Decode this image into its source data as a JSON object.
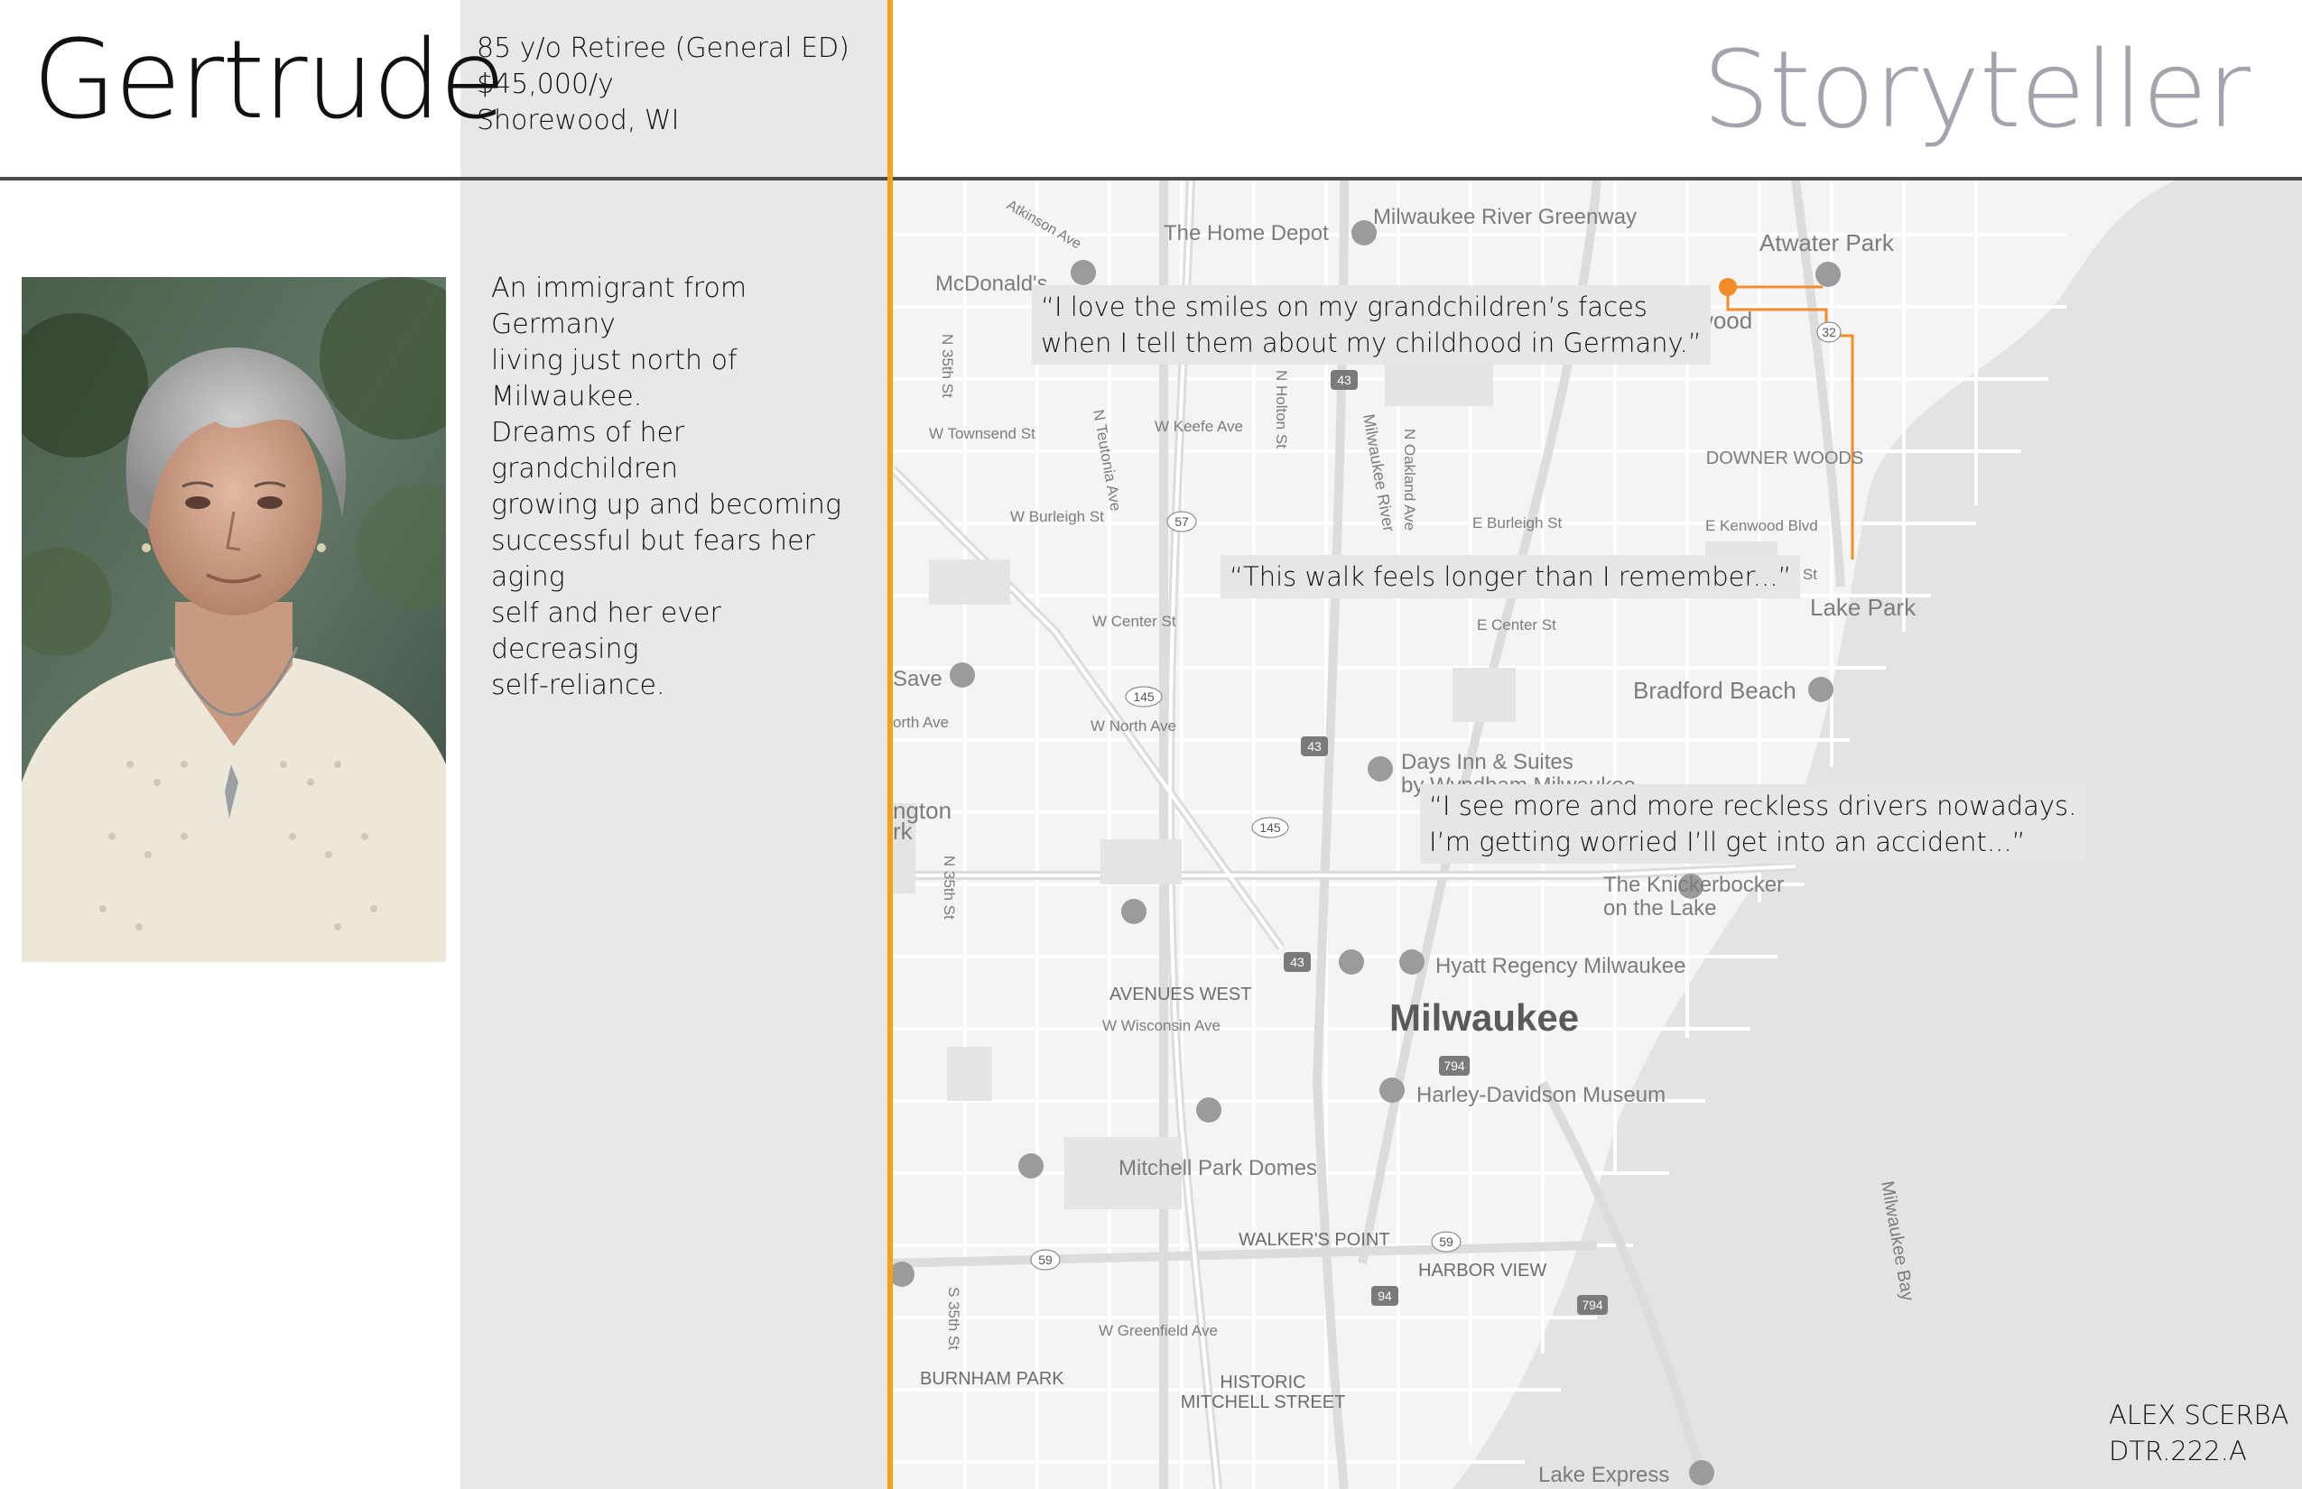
{
  "persona": {
    "name": "Gertrude",
    "age_line": "85 y/o Retiree (General ED)",
    "income_line": "$45,000/y",
    "location_line": "Shorewood, WI",
    "archetype": "Storyteller",
    "bio_lines": [
      "An immigrant from Germany",
      "living just north of Milwaukee.",
      "Dreams of her grandchildren",
      "growing up and becoming",
      "successful but fears her aging",
      "self and her ever decreasing",
      "self-reliance."
    ]
  },
  "quotes": {
    "q1_line1": "“I love the smiles on my grandchildren’s faces",
    "q1_line2": "when I tell them about my childhood in Germany.”",
    "q2": "“This walk feels longer than I remember...”",
    "q3_line1": "“I see more and more reckless drivers nowadays.",
    "q3_line2": "I’m getting worried I’ll get into an accident...”"
  },
  "map": {
    "labels": {
      "atkinson": "Atkinson Ave",
      "home_depot": "The Home Depot",
      "milwaukee_river_greenway": "Milwaukee River Greenway",
      "atwater_park": "Atwater Park",
      "mcdonalds": "McDonald's",
      "shorewood": "horewood",
      "n35_1": "N 35th St",
      "teutonia": "N Teutonia Ave",
      "n_holton": "N Holton St",
      "milwaukee_river": "Milwaukee River",
      "n_oakland": "N Oakland Ave",
      "downer_woods": "DOWNER WOODS",
      "w_townsend": "W Townsend St",
      "w_keefe": "W Keefe Ave",
      "w_burleigh": "W Burleigh St",
      "e_burleigh": "E Burleigh St",
      "e_kenwood": "E Kenwood Blvd",
      "e_locust": "E Locust St",
      "lake_park": "Lake Park",
      "w_center": "W Center St",
      "e_center": "E Center St",
      "save": "Save",
      "north_ave_left": "orth Ave",
      "bradford_beach": "Bradford Beach",
      "w_north": "W North Ave",
      "days_inn": "Days Inn & Suites",
      "by_wyndham": "by Wyndham Milwaukee",
      "washington_park_1": "ngton",
      "washington_park_2": "rk",
      "n35_2": "N 35th St",
      "knickerbocker_1": "The Knickerbocker",
      "knickerbocker_2": "on the Lake",
      "hyatt": "Hyatt Regency Milwaukee",
      "avenues_west": "AVENUES WEST",
      "w_wisconsin": "W Wisconsin Ave",
      "milwaukee": "Milwaukee",
      "harley": "Harley-Davidson Museum",
      "mitchell_domes": "Mitchell Park Domes",
      "milwaukee_bay": "Milwaukee Bay",
      "walkers_point": "WALKER'S POINT",
      "harbor_view": "HARBOR VIEW",
      "s35": "S 35th St",
      "w_greenfield": "W Greenfield Ave",
      "burnham_park": "BURNHAM PARK",
      "historic_1": "HISTORIC",
      "historic_2": "MITCHELL STREET",
      "lake_express": "Lake Express"
    },
    "shields": {
      "i43_a": "43",
      "r57": "57",
      "r145_a": "145",
      "i43_b": "43",
      "r145_b": "145",
      "i43_c": "43",
      "i794_a": "794",
      "r59_a": "59",
      "r59_b": "59",
      "i94": "94",
      "i794_b": "794",
      "r32": "32"
    }
  },
  "credit": {
    "author": "ALEX SCERBA",
    "course": "DTR.222.A"
  },
  "colors": {
    "accent_orange": "#f5a01a",
    "route_orange": "#f28c28",
    "role_gray": "#a3a3ad",
    "panel_gray": "#e8e8e8"
  }
}
